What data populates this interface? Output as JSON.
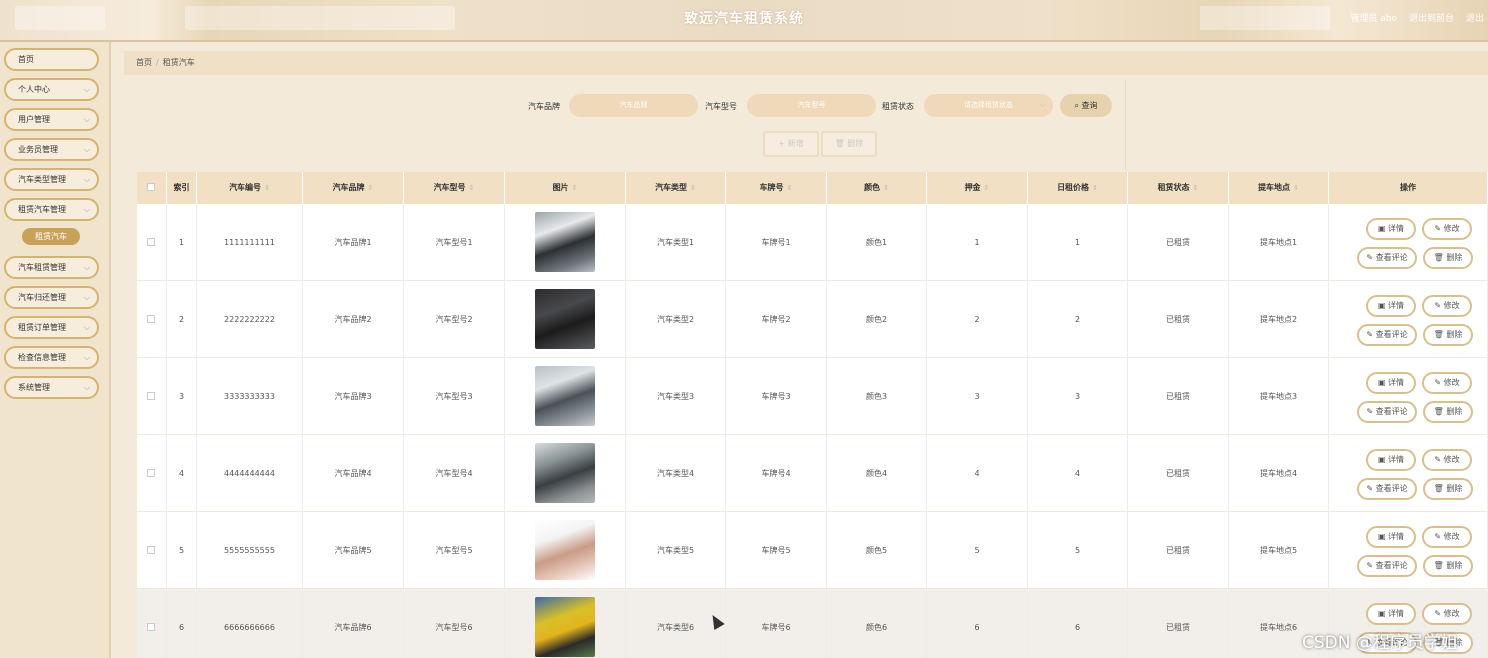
{
  "header": {
    "title": "致远汽车租赁系统",
    "admin": "管理员 abo",
    "back_front": "退出到前台",
    "logout": "退出"
  },
  "sidebar": {
    "items": [
      {
        "label": "首页"
      },
      {
        "label": "个人中心"
      },
      {
        "label": "用户管理"
      },
      {
        "label": "业务员管理"
      },
      {
        "label": "汽车类型管理"
      },
      {
        "label": "租赁汽车管理"
      },
      {
        "label": "汽车租赁管理"
      },
      {
        "label": "汽车归还管理"
      },
      {
        "label": "租赁订单管理"
      },
      {
        "label": "检查信息管理"
      },
      {
        "label": "系统管理"
      }
    ],
    "active_sub": "租赁汽车"
  },
  "breadcrumb": {
    "home": "首页",
    "current": "租赁汽车"
  },
  "search": {
    "brand_label": "汽车品牌",
    "brand_placeholder": "汽车品牌",
    "model_label": "汽车型号",
    "model_placeholder": "汽车型号",
    "status_label": "租赁状态",
    "status_placeholder": "请选择租赁状态",
    "query_button": "查询",
    "add_button": "新增",
    "delete_button": "删除"
  },
  "table": {
    "columns": [
      "索引",
      "汽车编号",
      "汽车品牌",
      "汽车型号",
      "图片",
      "汽车类型",
      "车牌号",
      "颜色",
      "押金",
      "日租价格",
      "租赁状态",
      "提车地点",
      "操作"
    ],
    "rows": [
      {
        "index": "1",
        "code": "1111111111",
        "brand": "汽车品牌1",
        "model": "汽车型号1",
        "type": "汽车类型1",
        "plate": "车牌号1",
        "color": "颜色1",
        "deposit": "1",
        "price": "1",
        "status": "已租赁",
        "place": "提车地点1"
      },
      {
        "index": "2",
        "code": "2222222222",
        "brand": "汽车品牌2",
        "model": "汽车型号2",
        "type": "汽车类型2",
        "plate": "车牌号2",
        "color": "颜色2",
        "deposit": "2",
        "price": "2",
        "status": "已租赁",
        "place": "提车地点2"
      },
      {
        "index": "3",
        "code": "3333333333",
        "brand": "汽车品牌3",
        "model": "汽车型号3",
        "type": "汽车类型3",
        "plate": "车牌号3",
        "color": "颜色3",
        "deposit": "3",
        "price": "3",
        "status": "已租赁",
        "place": "提车地点3"
      },
      {
        "index": "4",
        "code": "4444444444",
        "brand": "汽车品牌4",
        "model": "汽车型号4",
        "type": "汽车类型4",
        "plate": "车牌号4",
        "color": "颜色4",
        "deposit": "4",
        "price": "4",
        "status": "已租赁",
        "place": "提车地点4"
      },
      {
        "index": "5",
        "code": "5555555555",
        "brand": "汽车品牌5",
        "model": "汽车型号5",
        "type": "汽车类型5",
        "plate": "车牌号5",
        "color": "颜色5",
        "deposit": "5",
        "price": "5",
        "status": "已租赁",
        "place": "提车地点5"
      },
      {
        "index": "6",
        "code": "6666666666",
        "brand": "汽车品牌6",
        "model": "汽车型号6",
        "type": "汽车类型6",
        "plate": "车牌号6",
        "color": "颜色6",
        "deposit": "6",
        "price": "6",
        "status": "已租赁",
        "place": "提车地点6"
      }
    ],
    "actions": {
      "detail": "详情",
      "edit": "修改",
      "reviews": "查看评论",
      "delete": "删除"
    }
  },
  "watermark": "CSDN @程序员学姐",
  "colors": {
    "accent": "#c9a25a",
    "header_bg": "#eadcc4",
    "sidebar_bg": "#f1e4cd",
    "table_head": "#f1e0c3",
    "button_border": "#d8c08c"
  }
}
